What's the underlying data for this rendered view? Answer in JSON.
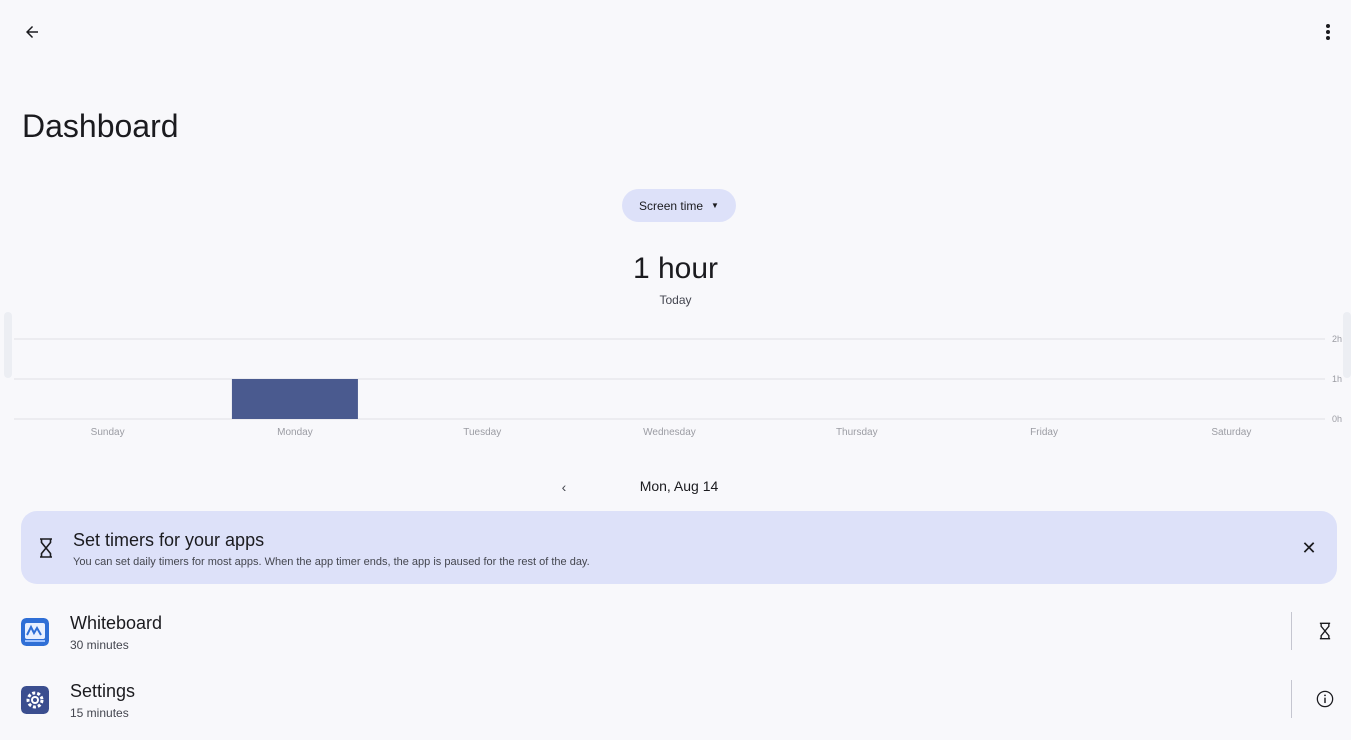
{
  "header": {
    "back_icon": "arrow-back-icon",
    "more_icon": "more-vert-icon",
    "title": "Dashboard"
  },
  "metric_selector": {
    "label": "Screen time",
    "caret_icon": "dropdown-caret-icon"
  },
  "summary": {
    "value": "1 hour",
    "caption": "Today"
  },
  "chart_data": {
    "type": "bar",
    "categories": [
      "Sunday",
      "Monday",
      "Tuesday",
      "Wednesday",
      "Thursday",
      "Friday",
      "Saturday"
    ],
    "values": [
      0,
      1,
      0,
      0,
      0,
      0,
      0
    ],
    "y_ticks": [
      "2h",
      "1h",
      "0h"
    ],
    "ylim": [
      0,
      2
    ],
    "unit": "hours",
    "grid": true,
    "bar_color": "#4a5a8f"
  },
  "date_nav": {
    "prev_icon": "chevron-left-icon",
    "label": "Mon, Aug 14"
  },
  "banner": {
    "icon": "hourglass-icon",
    "title": "Set timers for your apps",
    "body": "You can set daily timers for most apps. When the app timer ends, the app is paused for the rest of the day.",
    "close_icon": "close-icon"
  },
  "apps": [
    {
      "name": "Whiteboard",
      "time": "30 minutes",
      "icon": "whiteboard-app-icon",
      "action_icon": "hourglass-icon"
    },
    {
      "name": "Settings",
      "time": "15 minutes",
      "icon": "settings-app-icon",
      "action_icon": "info-icon"
    }
  ],
  "colors": {
    "background": "#f8f8fb",
    "chip": "#dde1f9",
    "banner": "#dde1f9",
    "bar": "#4a5a8f"
  }
}
